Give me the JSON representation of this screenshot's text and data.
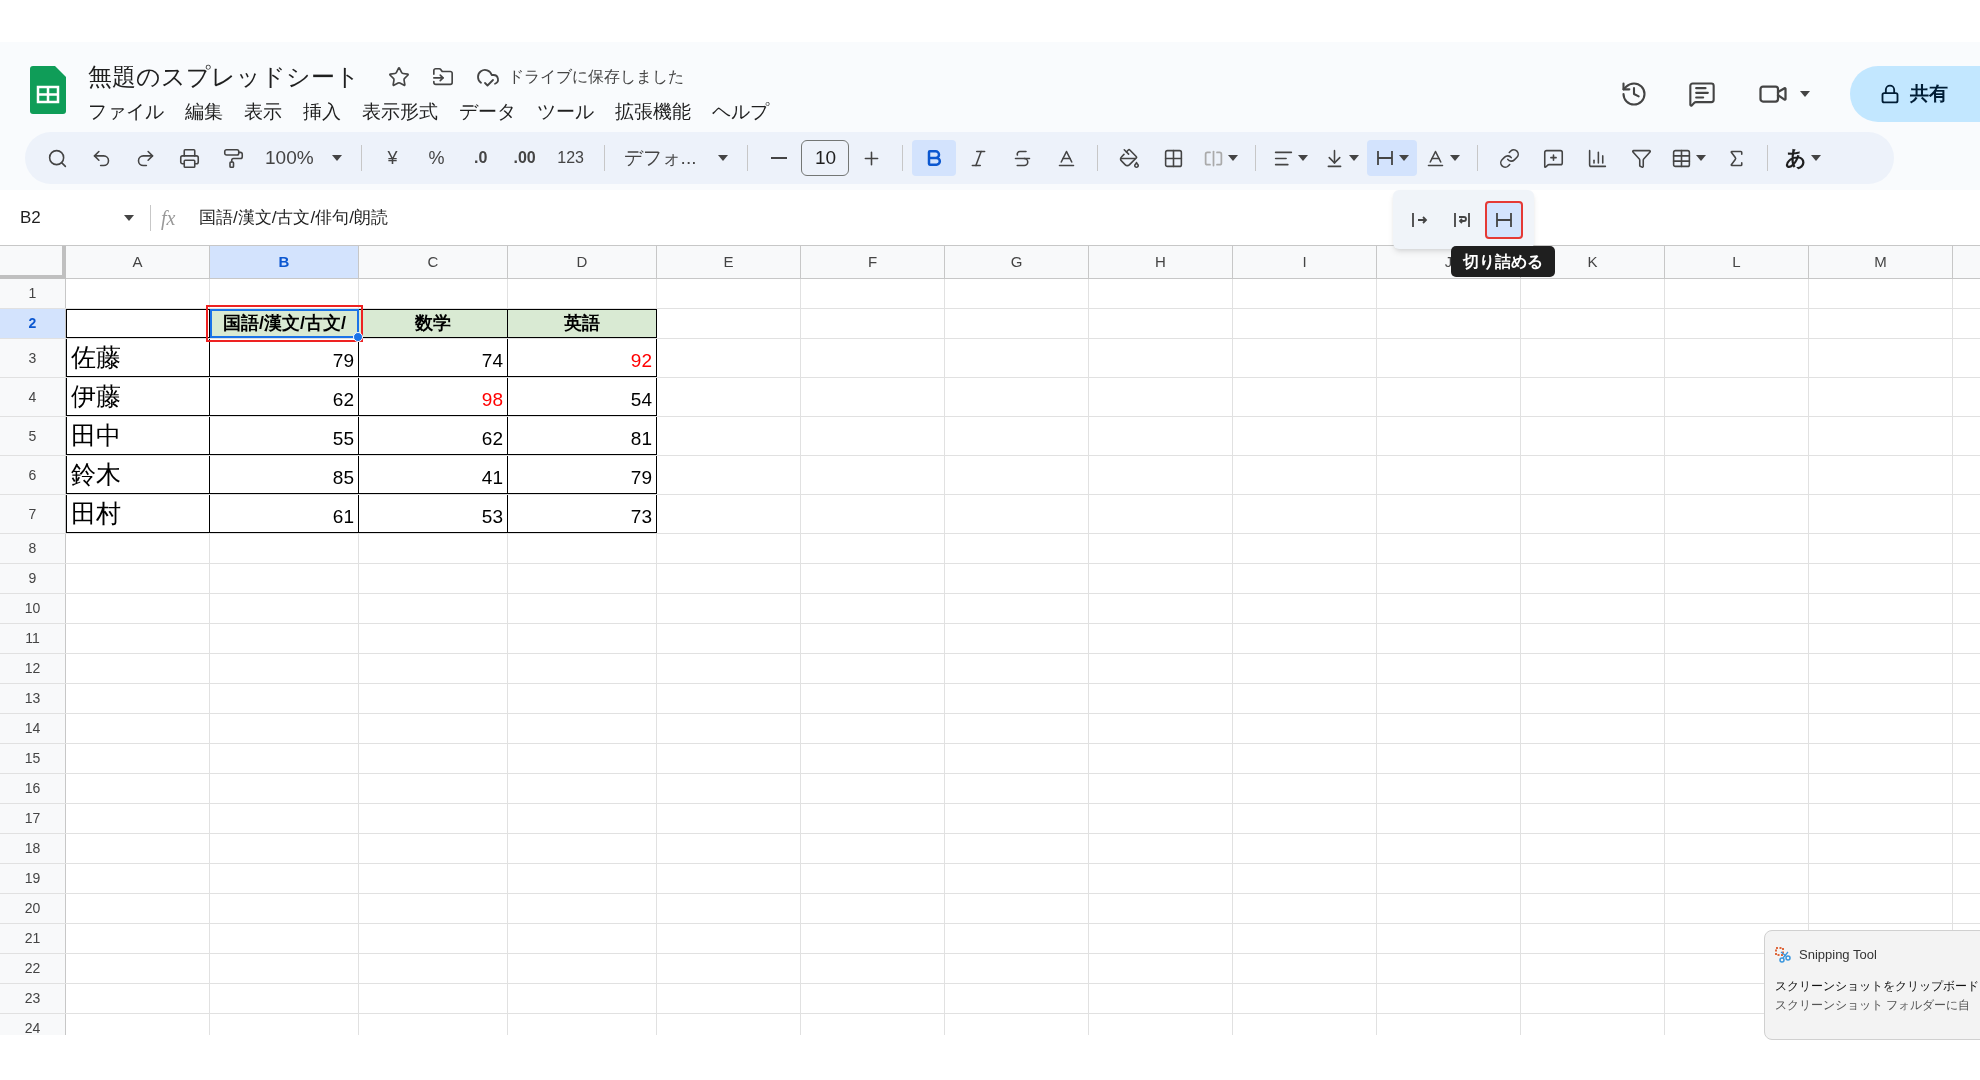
{
  "document": {
    "title": "無題のスプレッドシート",
    "starred": false,
    "save_status": "ドライブに保存しました"
  },
  "menu": [
    "ファイル",
    "編集",
    "表示",
    "挿入",
    "表示形式",
    "データ",
    "ツール",
    "拡張機能",
    "ヘルプ"
  ],
  "share": {
    "label": "共有"
  },
  "toolbar": {
    "zoom": "100%",
    "currency": "¥",
    "percent": "%",
    "decrease_decimal": ".0",
    "increase_decimal": ".00",
    "number_format": "123",
    "font": "デフォ...",
    "font_size": "10",
    "bold": true,
    "input_mode": "あ"
  },
  "wrap_menu": {
    "options": [
      {
        "kind": "overflow",
        "selected": false
      },
      {
        "kind": "wrap",
        "selected": false
      },
      {
        "kind": "clip",
        "selected": true
      }
    ],
    "tooltip": "切り詰める"
  },
  "formula_bar": {
    "cell_ref": "B2",
    "function_label": "fx",
    "content": "国語/漢文/古文/俳句/朗読"
  },
  "sheet": {
    "columns": [
      {
        "label": "A",
        "selected": false
      },
      {
        "label": "B",
        "selected": true
      },
      {
        "label": "C",
        "selected": false
      },
      {
        "label": "D",
        "selected": false
      },
      {
        "label": "E",
        "selected": false
      },
      {
        "label": "F",
        "selected": false
      },
      {
        "label": "G",
        "selected": false
      },
      {
        "label": "H",
        "selected": false
      },
      {
        "label": "I",
        "selected": false
      },
      {
        "label": "J",
        "selected": false
      },
      {
        "label": "K",
        "selected": false
      },
      {
        "label": "L",
        "selected": false
      },
      {
        "label": "M",
        "selected": false
      }
    ],
    "rows": [
      {
        "label": "1",
        "selected": false
      },
      {
        "label": "2",
        "selected": true,
        "cells": [
          {
            "kind": "empty",
            "selected": false
          },
          {
            "kind": "header",
            "text": "国語/漢文/古文/",
            "selected": true
          },
          {
            "kind": "header",
            "text": "数学",
            "selected": false
          },
          {
            "kind": "header",
            "text": "英語",
            "selected": false
          }
        ]
      },
      {
        "label": "3",
        "selected": false,
        "cells": [
          {
            "kind": "name",
            "text": "佐藤",
            "selected": false
          },
          {
            "kind": "number",
            "text": "79",
            "color": "#000000",
            "selected": false
          },
          {
            "kind": "number",
            "text": "74",
            "color": "#000000",
            "selected": false
          },
          {
            "kind": "number",
            "text": "92",
            "color": "#ff0000",
            "selected": false
          }
        ]
      },
      {
        "label": "4",
        "selected": false,
        "cells": [
          {
            "kind": "name",
            "text": "伊藤",
            "selected": false
          },
          {
            "kind": "number",
            "text": "62",
            "color": "#000000",
            "selected": false
          },
          {
            "kind": "number",
            "text": "98",
            "color": "#ff0000",
            "selected": false
          },
          {
            "kind": "number",
            "text": "54",
            "color": "#000000",
            "selected": false
          }
        ]
      },
      {
        "label": "5",
        "selected": false,
        "cells": [
          {
            "kind": "name",
            "text": "田中",
            "selected": false
          },
          {
            "kind": "number",
            "text": "55",
            "color": "#000000",
            "selected": false
          },
          {
            "kind": "number",
            "text": "62",
            "color": "#000000",
            "selected": false
          },
          {
            "kind": "number",
            "text": "81",
            "color": "#000000",
            "selected": false
          }
        ]
      },
      {
        "label": "6",
        "selected": false,
        "cells": [
          {
            "kind": "name",
            "text": "鈴木",
            "selected": false
          },
          {
            "kind": "number",
            "text": "85",
            "color": "#000000",
            "selected": false
          },
          {
            "kind": "number",
            "text": "41",
            "color": "#000000",
            "selected": false
          },
          {
            "kind": "number",
            "text": "79",
            "color": "#000000",
            "selected": false
          }
        ]
      },
      {
        "label": "7",
        "selected": false,
        "cells": [
          {
            "kind": "name",
            "text": "田村",
            "selected": false
          },
          {
            "kind": "number",
            "text": "61",
            "color": "#000000",
            "selected": false
          },
          {
            "kind": "number",
            "text": "53",
            "color": "#000000",
            "selected": false
          },
          {
            "kind": "number",
            "text": "73",
            "color": "#000000",
            "selected": false
          }
        ]
      },
      {
        "label": "8",
        "selected": false
      },
      {
        "label": "9",
        "selected": false
      },
      {
        "label": "10",
        "selected": false
      },
      {
        "label": "11",
        "selected": false
      },
      {
        "label": "12",
        "selected": false
      },
      {
        "label": "13",
        "selected": false
      },
      {
        "label": "14",
        "selected": false
      },
      {
        "label": "15",
        "selected": false
      },
      {
        "label": "16",
        "selected": false
      },
      {
        "label": "17",
        "selected": false
      },
      {
        "label": "18",
        "selected": false
      },
      {
        "label": "19",
        "selected": false
      },
      {
        "label": "20",
        "selected": false
      },
      {
        "label": "21",
        "selected": false
      },
      {
        "label": "22",
        "selected": false
      },
      {
        "label": "23",
        "selected": false
      },
      {
        "label": "24",
        "selected": false
      }
    ]
  },
  "notification": {
    "app": "Snipping Tool",
    "title": "スクリーンショットをクリップボード",
    "body": "スクリーンショット フォルダーに自"
  }
}
